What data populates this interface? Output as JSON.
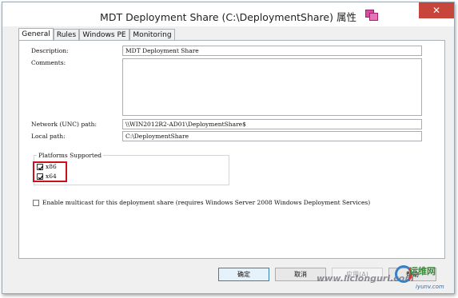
{
  "window": {
    "title": "MDT Deployment Share (C:\\DeploymentShare) 属性",
    "close_glyph": "✕"
  },
  "tabs": [
    {
      "label": "General",
      "active": true
    },
    {
      "label": "Rules",
      "active": false
    },
    {
      "label": "Windows PE",
      "active": false
    },
    {
      "label": "Monitoring",
      "active": false
    }
  ],
  "form": {
    "description_label": "Description:",
    "description_value": "MDT Deployment Share",
    "comments_label": "Comments:",
    "comments_value": "",
    "network_path_label": "Network (UNC) path:",
    "network_path_value": "\\\\WIN2012R2-AD01\\DeploymentShare$",
    "local_path_label": "Local path:",
    "local_path_value": "C:\\DeploymentShare"
  },
  "platforms": {
    "title": "Platforms Supported",
    "items": [
      {
        "label": "x86",
        "checked": true
      },
      {
        "label": "x64",
        "checked": true
      }
    ],
    "highlight_color": "#c8101e"
  },
  "multicast": {
    "label": "Enable multicast for this deployment share (requires Windows Server 2008 Windows Deployment Services)",
    "checked": false
  },
  "buttons": {
    "ok": "确定",
    "cancel": "取消",
    "apply": "应用(A)",
    "help": "帮助"
  },
  "watermark": {
    "site": "www.liclonguri.com",
    "name": "运维网",
    "domain": "iyunv.com"
  },
  "colors": {
    "close_button": "#c7453a",
    "dialog_background": "#f0f0f0"
  }
}
